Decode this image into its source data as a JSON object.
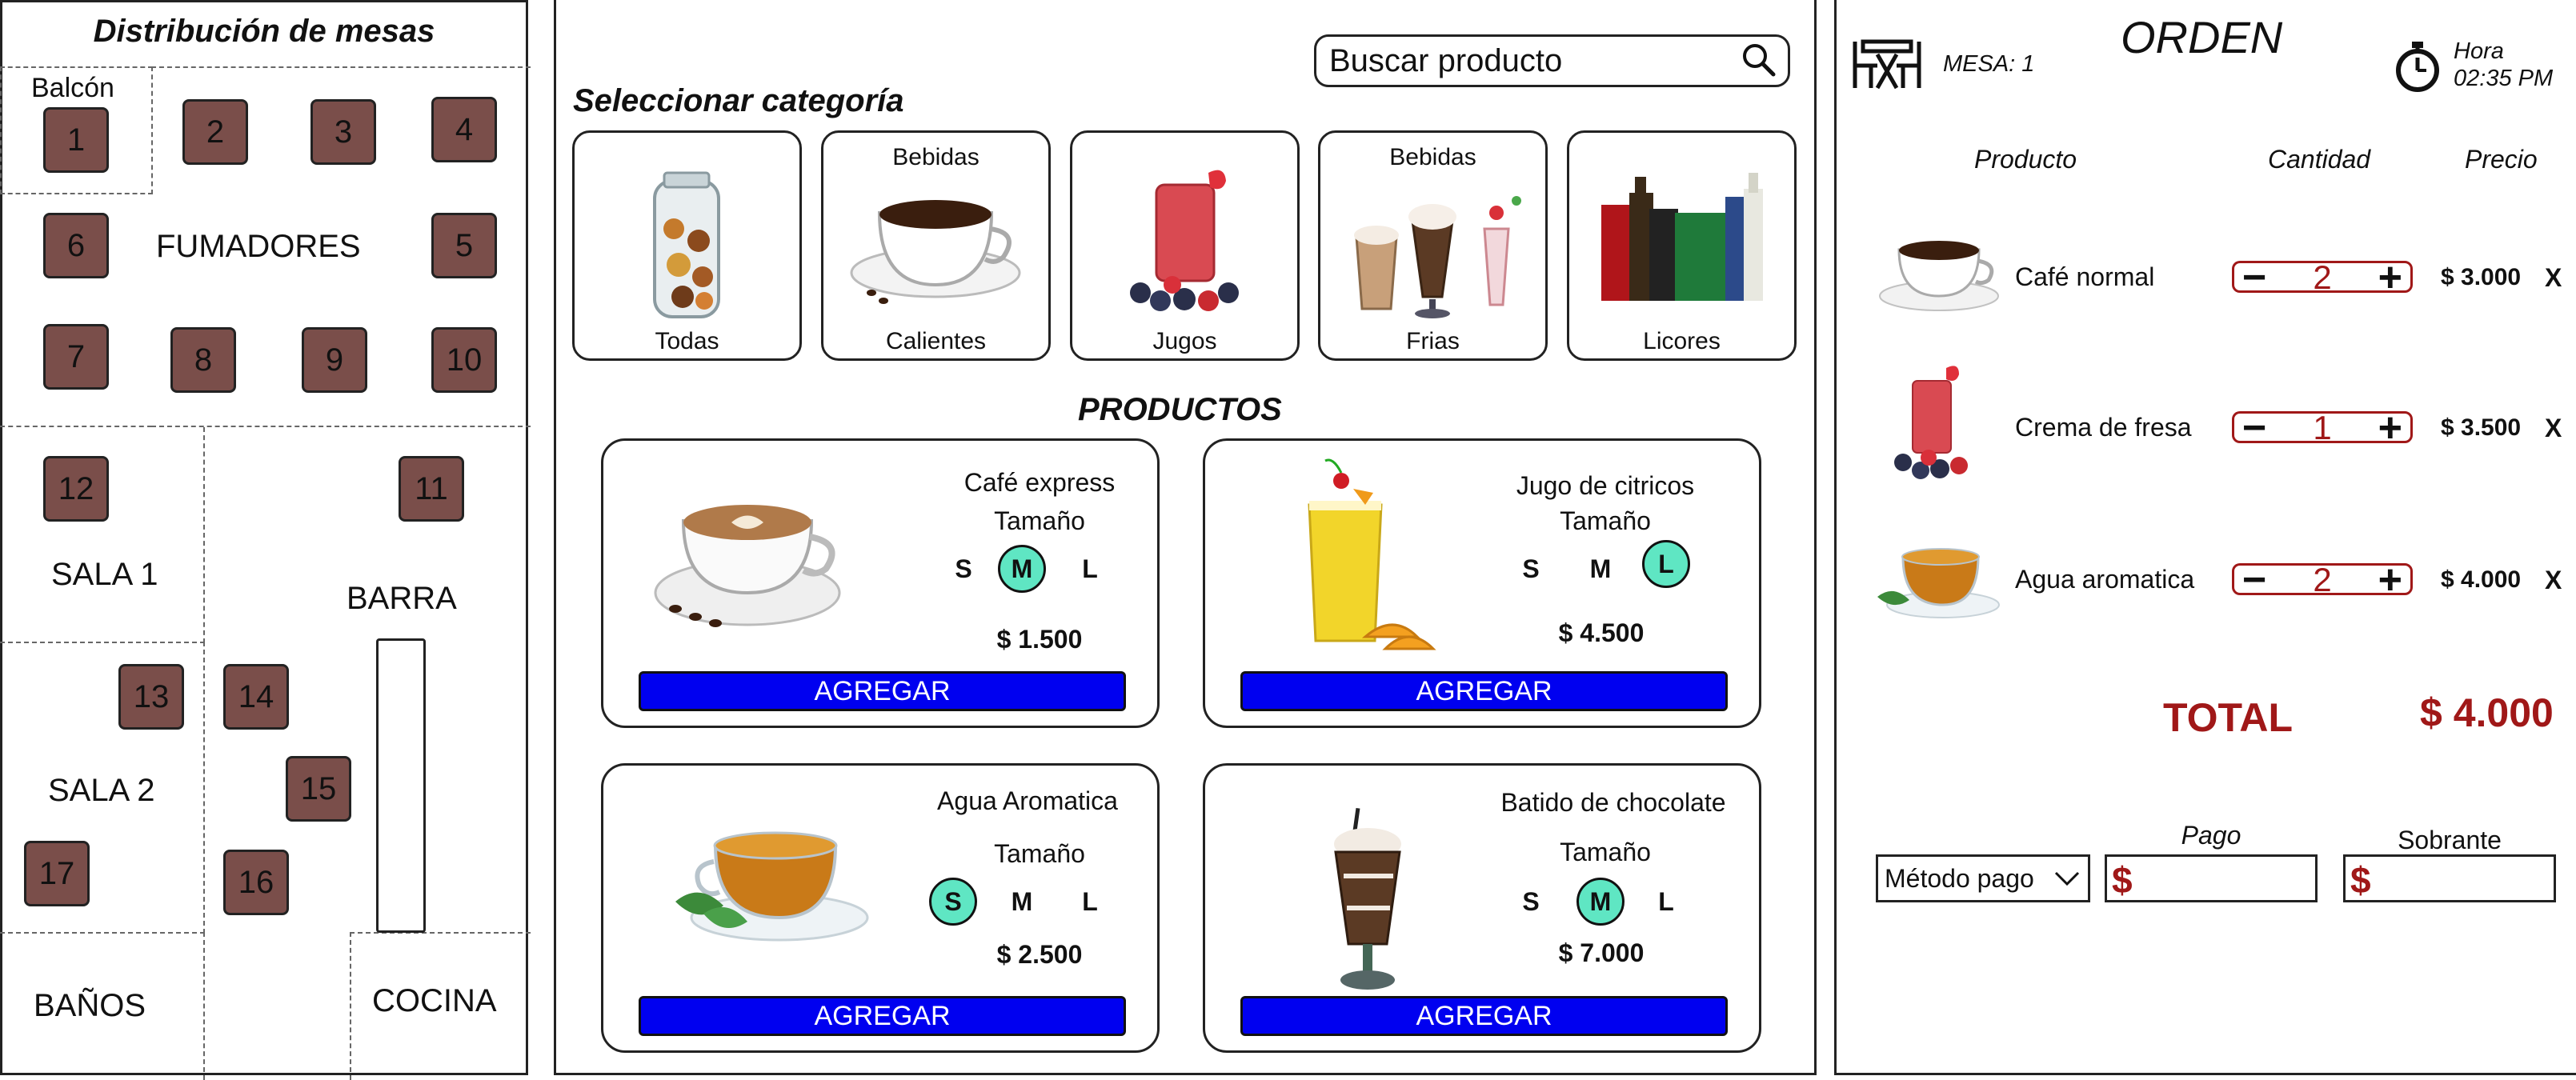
{
  "map": {
    "title": "Distribución de mesas",
    "zones": {
      "balcon": "Balcón",
      "fumadores": "FUMADORES",
      "sala1": "SALA 1",
      "barra": "BARRA",
      "sala2": "SALA 2",
      "banos": "BAÑOS",
      "cocina": "COCINA"
    },
    "tables": [
      "1",
      "2",
      "3",
      "4",
      "5",
      "6",
      "7",
      "8",
      "9",
      "10",
      "11",
      "12",
      "13",
      "14",
      "15",
      "16",
      "17"
    ]
  },
  "search": {
    "placeholder": "Buscar producto",
    "icon": "search-icon"
  },
  "categories": {
    "title": "Seleccionar categoría",
    "items": [
      {
        "top": "",
        "label": "Todas",
        "icon": "jar-icon"
      },
      {
        "top": "Bebidas",
        "label": "Calientes",
        "icon": "coffee-cup-icon"
      },
      {
        "top": "",
        "label": "Jugos",
        "icon": "juice-icon"
      },
      {
        "top": "Bebidas",
        "label": "Frias",
        "icon": "milkshake-icon"
      },
      {
        "top": "",
        "label": "Licores",
        "icon": "bottles-icon"
      }
    ]
  },
  "products": {
    "title": "PRODUCTOS",
    "size_label": "Tamaño",
    "sizes": [
      "S",
      "M",
      "L"
    ],
    "add_label": "AGREGAR",
    "items": [
      {
        "name": "Café express",
        "price": "$ 1.500",
        "selected": "M",
        "icon": "latte-icon"
      },
      {
        "name": "Jugo de citricos",
        "price": "$ 4.500",
        "selected": "L",
        "icon": "citrus-juice-icon"
      },
      {
        "name": "Agua Aromatica",
        "price": "$ 2.500",
        "selected": "S",
        "icon": "tea-cup-icon"
      },
      {
        "name": "Batido de chocolate",
        "price": "$ 7.000",
        "selected": "M",
        "icon": "chocolate-shake-icon"
      }
    ]
  },
  "order": {
    "title": "ORDEN",
    "table_label": "MESA: 1",
    "time_label": "Hora",
    "time": "02:35 PM",
    "headers": {
      "product": "Producto",
      "quantity": "Cantidad",
      "price": "Precio"
    },
    "items": [
      {
        "name": "Café normal",
        "qty": "2",
        "price": "$ 3.000",
        "remove": "X"
      },
      {
        "name": "Crema de fresa",
        "qty": "1",
        "price": "$ 3.500",
        "remove": "X"
      },
      {
        "name": "Agua aromatica",
        "qty": "2",
        "price": "$ 4.000",
        "remove": "X"
      }
    ],
    "total_label": "TOTAL",
    "total": "$ 4.000",
    "payment": {
      "method_value": "Método pago",
      "pago_label": "Pago",
      "sobrante_label": "Sobrante",
      "currency": "$"
    }
  },
  "colors": {
    "table_fill": "#7a4e4a",
    "selected_size": "#5fe6c3",
    "add_button": "#0000f0",
    "accent_red": "#a01818"
  }
}
